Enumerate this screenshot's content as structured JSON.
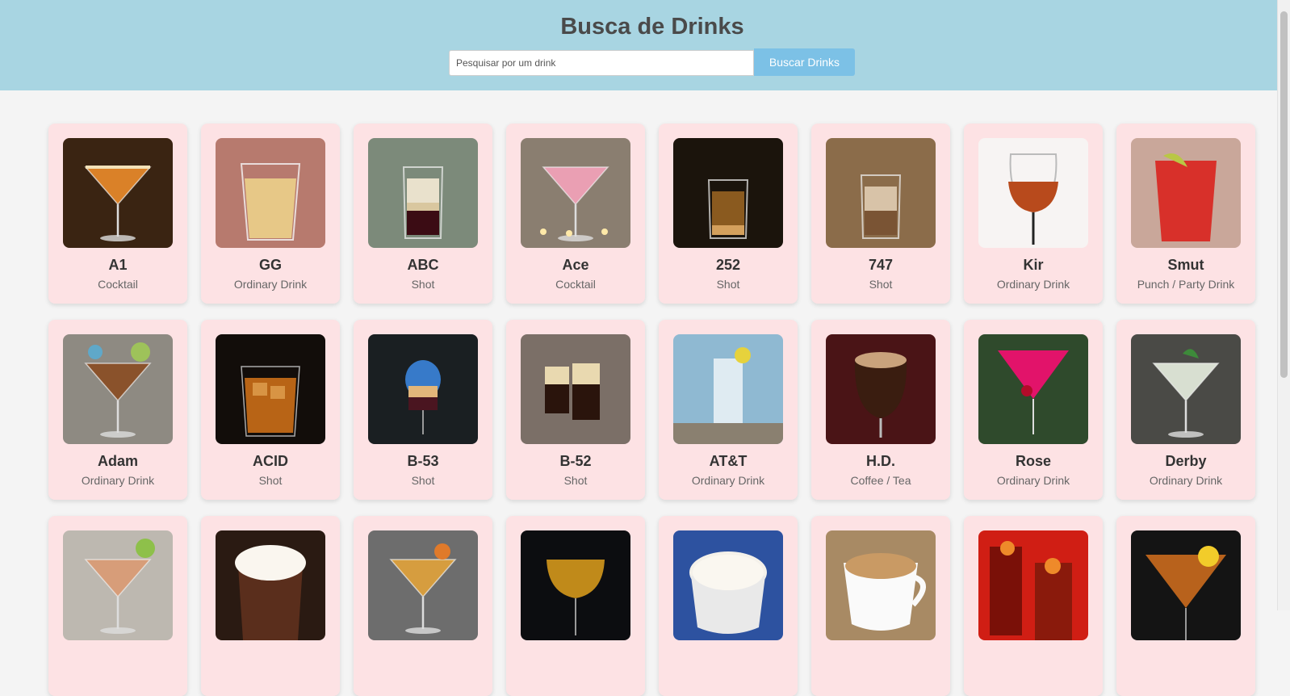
{
  "header": {
    "title": "Busca de Drinks",
    "search_placeholder": "Pesquisar por um drink",
    "search_value": "",
    "button_label": "Buscar Drinks"
  },
  "colors": {
    "header_bg": "#a8d5e2",
    "card_bg": "#fde2e4",
    "button_bg": "#7cc1e6",
    "page_bg": "#f4f4f4"
  },
  "drinks": [
    {
      "name": "A1",
      "category": "Cocktail",
      "image": "orange-martini-glass"
    },
    {
      "name": "GG",
      "category": "Ordinary Drink",
      "image": "clear-tumbler"
    },
    {
      "name": "ABC",
      "category": "Shot",
      "image": "layered-shot"
    },
    {
      "name": "Ace",
      "category": "Cocktail",
      "image": "pink-martini-glass"
    },
    {
      "name": "252",
      "category": "Shot",
      "image": "amber-shot"
    },
    {
      "name": "747",
      "category": "Shot",
      "image": "cream-shot"
    },
    {
      "name": "Kir",
      "category": "Ordinary Drink",
      "image": "wine-glass"
    },
    {
      "name": "Smut",
      "category": "Punch / Party Drink",
      "image": "red-punch-glass"
    },
    {
      "name": "Adam",
      "category": "Ordinary Drink",
      "image": "brown-martini-glass"
    },
    {
      "name": "ACID",
      "category": "Shot",
      "image": "whiskey-rocks"
    },
    {
      "name": "B-53",
      "category": "Shot",
      "image": "flaming-shot"
    },
    {
      "name": "B-52",
      "category": "Shot",
      "image": "layered-shots"
    },
    {
      "name": "AT&T",
      "category": "Ordinary Drink",
      "image": "highball-lemon"
    },
    {
      "name": "H.D.",
      "category": "Coffee / Tea",
      "image": "irish-coffee"
    },
    {
      "name": "Rose",
      "category": "Ordinary Drink",
      "image": "cherry-martini"
    },
    {
      "name": "Derby",
      "category": "Ordinary Drink",
      "image": "clear-martini-mint"
    },
    {
      "name": "",
      "category": "",
      "image": "grapefruit-martini"
    },
    {
      "name": "",
      "category": "",
      "image": "whipped-cocoa"
    },
    {
      "name": "",
      "category": "",
      "image": "orange-coupe"
    },
    {
      "name": "",
      "category": "",
      "image": "golden-coupe"
    },
    {
      "name": "",
      "category": "",
      "image": "foam-coffee-cup"
    },
    {
      "name": "",
      "category": "",
      "image": "latte-cup"
    },
    {
      "name": "",
      "category": "",
      "image": "red-sangria"
    },
    {
      "name": "",
      "category": "",
      "image": "lemon-twist-martini"
    }
  ]
}
